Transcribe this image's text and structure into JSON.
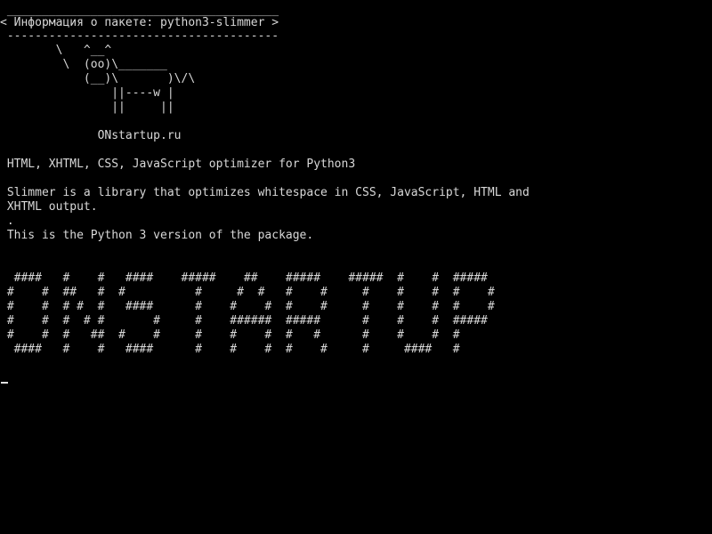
{
  "terminal": {
    "cowsay": {
      "border_top": " _______________________________________",
      "message": "< Информация о пакете: python3-slimmer >",
      "border_bottom": " ---------------------------------------",
      "cow": [
        "        \\   ^__^",
        "         \\  (oo)\\_______",
        "            (__)\\       )\\/\\",
        "                ||----w |",
        "                ||     ||"
      ]
    },
    "site": "              ONstartup.ru",
    "package": {
      "summary": " HTML, XHTML, CSS, JavaScript optimizer for Python3",
      "description": [
        " Slimmer is a library that optimizes whitespace in CSS, JavaScript, HTML and",
        " XHTML output.",
        " .",
        " This is the Python 3 version of the package."
      ]
    },
    "banner": [
      "  ####   #    #   ####    #####    ##    #####    #####  #    #  #####",
      " #    #  ##   #  #          #     #  #   #    #     #    #    #  #    #",
      " #    #  # #  #   ####      #    #    #  #    #     #    #    #  #    #",
      " #    #  #  # #       #     #    ######  #####      #    #    #  #####",
      " #    #  #   ##  #    #     #    #    #  #   #      #    #    #  #",
      "  ####   #    #   ####      #    #    #  #    #     #     ####   #"
    ]
  }
}
